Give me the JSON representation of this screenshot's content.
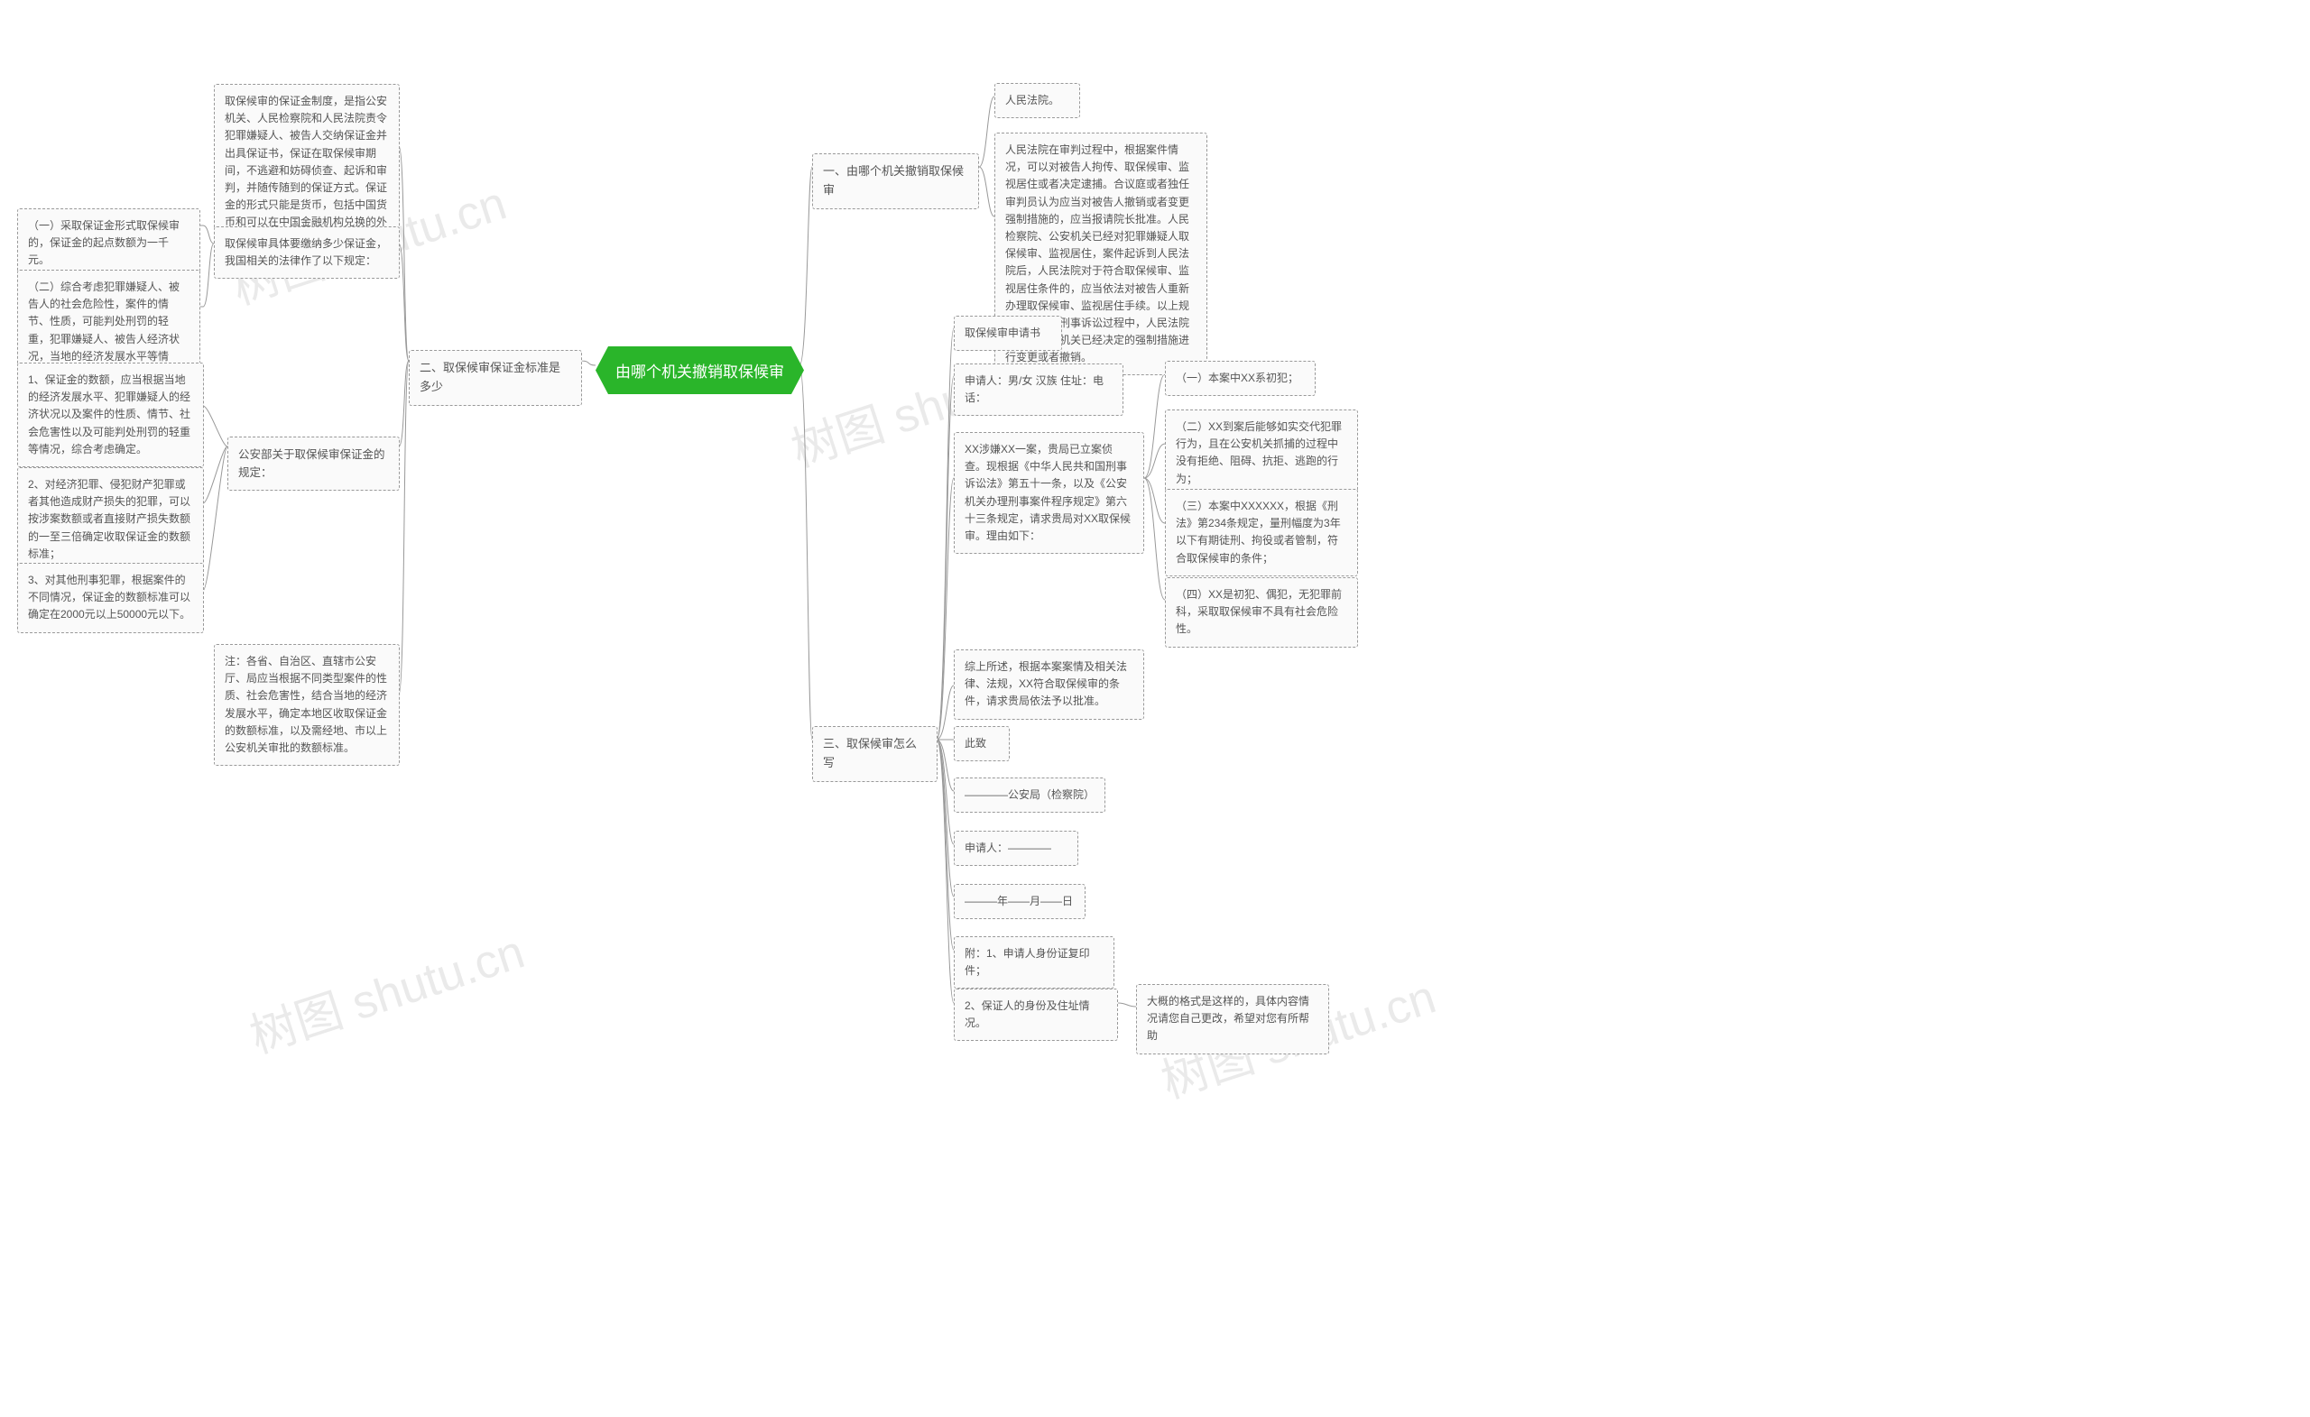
{
  "center": "由哪个机关撤销取保候审",
  "watermarks": [
    "树图 shutu.cn",
    "树图 shutu.cn",
    "树图 shutu.cn",
    "树图 shutu.cn"
  ],
  "left": {
    "sec2": "二、取保候审保证金标准是多少",
    "l1": "取保候审的保证金制度，是指公安机关、人民检察院和人民法院责令犯罪嫌疑人、被告人交纳保证金并出具保证书，保证在取保候审期间，不逃避和妨碍侦查、起诉和审判，并随传随到的保证方式。保证金的形式只能是货币，包括中国货币和可以在中国金融机构兑换的外国货币。",
    "l2": "取保候审具体要缴纳多少保证金，我国相关的法律作了以下规定：",
    "l2a": "（一）采取保证金形式取保候审的，保证金的起点数额为一千元。",
    "l2b": "（二）综合考虑犯罪嫌疑人、被告人的社会危险性，案件的情节、性质，可能判处刑罚的轻重，犯罪嫌疑人、被告人经济状况，当地的经济发展水平等情况，确定收取保证金的数额。",
    "l3": "公安部关于取保候审保证金的规定：",
    "l3a": "1、保证金的数额，应当根据当地的经济发展水平、犯罪嫌疑人的经济状况以及案件的性质、情节、社会危害性以及可能判处刑罚的轻重等情况，综合考虑确定。",
    "l3b": "2、对经济犯罪、侵犯财产犯罪或者其他造成财产损失的犯罪，可以按涉案数额或者直接财产损失数额的一至三倍确定收取保证金的数额标准；",
    "l3c": "3、对其他刑事犯罪，根据案件的不同情况，保证金的数额标准可以确定在2000元以上50000元以下。",
    "l4": "注：各省、自治区、直辖市公安厅、局应当根据不同类型案件的性质、社会危害性，结合当地的经济发展水平，确定本地区收取保证金的数额标准，以及需经地、市以上公安机关审批的数额标准。"
  },
  "right": {
    "sec1": "一、由哪个机关撤销取保候审",
    "r1a": "人民法院。",
    "r1b": "人民法院在审判过程中，根据案件情况，可以对被告人拘传、取保候审、监视居住或者决定逮捕。合议庭或者独任审判员认为应当对被告人撤销或者变更强制措施的，应当报请院长批准。人民检察院、公安机关已经对犯罪嫌疑人取保候审、监视居住，案件起诉到人民法院后，人民法院对于符合取保候审、监视居住条件的，应当依法对被告人重新办理取保候审、监视居住手续。以上规定说明，在刑事诉讼过程中，人民法院有权对其他机关已经决定的强制措施进行变更或者撤销。",
    "sec3": "三、取保候审怎么写",
    "r3a": "取保候审申请书",
    "r3b": "申请人：男/女 汉族 住址：电话：",
    "r3c": "XX涉嫌XX一案，贵局已立案侦查。现根据《中华人民共和国刑事诉讼法》第五十一条，以及《公安机关办理刑事案件程序规定》第六十三条规定，请求贵局对XX取保候审。理由如下：",
    "r3c1": "（一）本案中XX系初犯；",
    "r3c2": "（二）XX到案后能够如实交代犯罪行为，且在公安机关抓捕的过程中没有拒绝、阻碍、抗拒、逃跑的行为；",
    "r3c3": "（三）本案中XXXXXX，根据《刑法》第234条规定，量刑幅度为3年以下有期徒刑、拘役或者管制，符合取保候审的条件；",
    "r3c4": "（四）XX是初犯、偶犯，无犯罪前科，采取取保候审不具有社会危险性。",
    "r3d": "综上所述，根据本案案情及相关法律、法规，XX符合取保候审的条件，请求贵局依法予以批准。",
    "r3e": "此致",
    "r3f": "————公安局（检察院）",
    "r3g": "申请人：————",
    "r3h": "———年——月——日",
    "r3i": "附：1、申请人身份证复印件；",
    "r3j": "2、保证人的身份及住址情况。",
    "r3j1": "大概的格式是这样的，具体内容情况请您自己更改，希望对您有所帮助"
  }
}
